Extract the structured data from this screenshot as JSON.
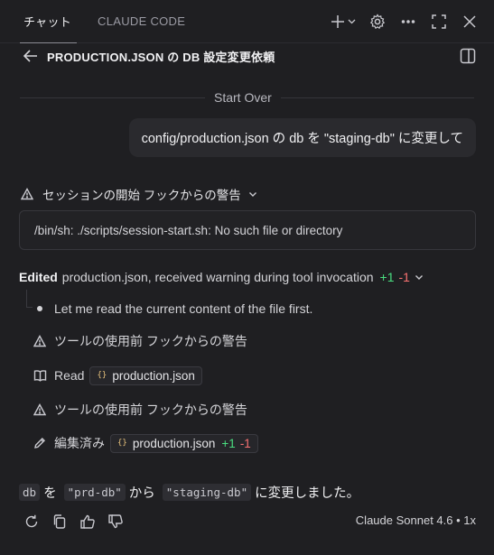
{
  "tabs": [
    {
      "label": "チャット"
    },
    {
      "label": "CLAUDE CODE"
    }
  ],
  "header": {
    "title": "PRODUCTION.JSON の DB 設定変更依頼"
  },
  "start_over_label": "Start Over",
  "user_message": "config/production.json の db を \"staging-db\" に変更して",
  "session_warning": {
    "label": "セッションの開始 フックからの警告",
    "error_text": "/bin/sh: ./scripts/session-start.sh: No such file or directory"
  },
  "edited_summary": {
    "bold": "Edited",
    "text": "production.json, received warning during tool invocation",
    "added": "+1",
    "removed": "-1"
  },
  "timeline": [
    {
      "icon": "dot-icon",
      "text": "Let me read the current content of the file first."
    },
    {
      "icon": "warning-icon",
      "text": "ツールの使用前 フックからの警告"
    },
    {
      "icon": "book-icon",
      "text": "Read",
      "file": "production.json"
    },
    {
      "icon": "warning-icon",
      "text": "ツールの使用前 フックからの警告"
    },
    {
      "icon": "pencil-icon",
      "text": "編集済み",
      "file": "production.json",
      "added": "+1",
      "removed": "-1"
    }
  ],
  "result": {
    "code1": "db",
    "text1": "を",
    "code2": "\"prd-db\"",
    "text2": "から",
    "code3": "\"staging-db\"",
    "text3": "に変更しました。"
  },
  "footer": {
    "model": "Claude Sonnet 4.6 • 1x"
  }
}
